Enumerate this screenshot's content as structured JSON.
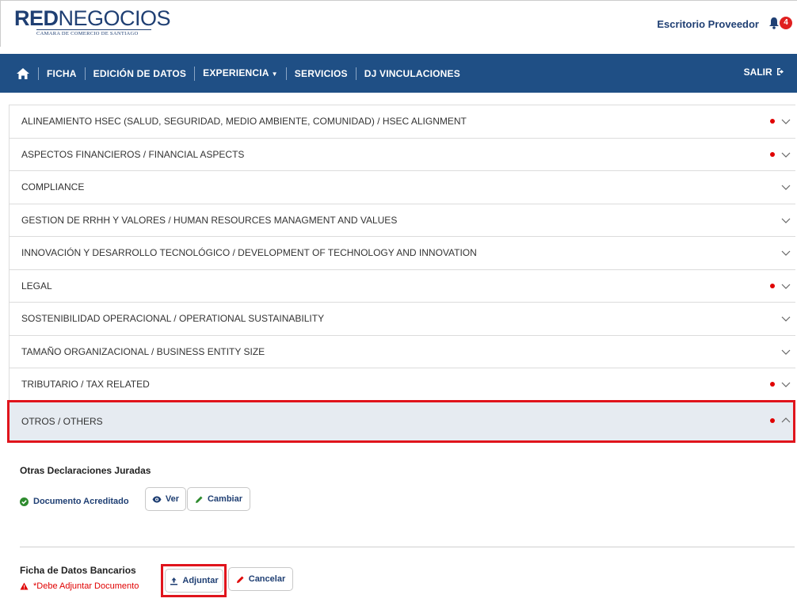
{
  "header": {
    "logo_red": "RED",
    "logo_neg": "NEGOCIOS",
    "logo_sub": "CAMARA DE COMERCIO DE SANTIAGO",
    "escritorio": "Escritorio Proveedor",
    "notif_count": "4"
  },
  "nav": {
    "items": [
      "FICHA",
      "EDICIÓN DE DATOS",
      "EXPERIENCIA",
      "SERVICIOS",
      "DJ VINCULACIONES"
    ],
    "salir": "SALIR"
  },
  "accordion": [
    {
      "label": "ALINEAMIENTO HSEC  (SALUD, SEGURIDAD, MEDIO AMBIENTE, COMUNIDAD) / HSEC ALIGNMENT",
      "alert": true
    },
    {
      "label": "ASPECTOS FINANCIEROS / FINANCIAL ASPECTS",
      "alert": true
    },
    {
      "label": "COMPLIANCE",
      "alert": false
    },
    {
      "label": "GESTION DE RRHH Y VALORES /   HUMAN RESOURCES MANAGMENT AND VALUES",
      "alert": false
    },
    {
      "label": "INNOVACIÓN   Y DESARROLLO TECNOLÓGICO  / DEVELOPMENT OF TECHNOLOGY AND INNOVATION",
      "alert": false
    },
    {
      "label": "LEGAL",
      "alert": true
    },
    {
      "label": "SOSTENIBILIDAD OPERACIONAL / OPERATIONAL SUSTAINABILITY",
      "alert": false
    },
    {
      "label": "TAMAÑO ORGANIZACIONAL / BUSINESS ENTITY SIZE",
      "alert": false
    },
    {
      "label": "TRIBUTARIO /  TAX RELATED",
      "alert": true
    },
    {
      "label": "OTROS / OTHERS",
      "alert": true
    }
  ],
  "otros": {
    "section1_title": "Otras Declaraciones Juradas",
    "section1_status": "Documento Acreditado",
    "ver": "Ver",
    "cambiar": "Cambiar",
    "section2_title": "Ficha de Datos Bancarios",
    "section2_status": "*Debe Adjuntar Documento",
    "adjuntar": "Adjuntar",
    "cancelar": "Cancelar"
  },
  "colors": {
    "navbar": "#1f4f85",
    "brand": "#1f3f73",
    "alert": "#e00000",
    "success": "#2e8b2e",
    "highlight": "#e0141c"
  }
}
